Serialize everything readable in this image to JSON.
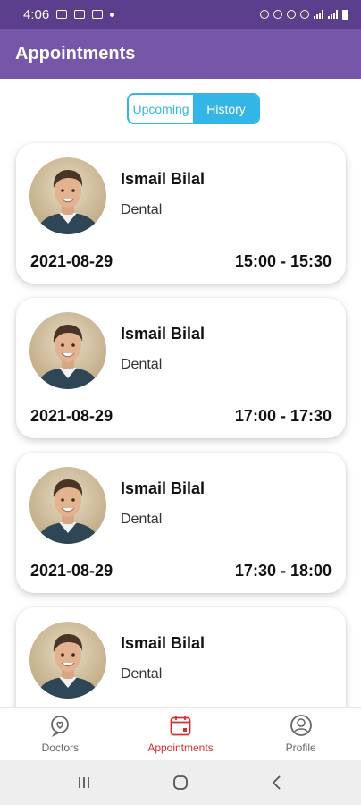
{
  "status_bar": {
    "time": "4:06"
  },
  "app_bar": {
    "title": "Appointments"
  },
  "segmented": {
    "upcoming_label": "Upcoming",
    "history_label": "History",
    "selected": "History"
  },
  "appointments": [
    {
      "name": "Ismail Bilal",
      "specialty": "Dental",
      "date": "2021-08-29",
      "time": "15:00 - 15:30"
    },
    {
      "name": "Ismail Bilal",
      "specialty": "Dental",
      "date": "2021-08-29",
      "time": "17:00 - 17:30"
    },
    {
      "name": "Ismail Bilal",
      "specialty": "Dental",
      "date": "2021-08-29",
      "time": "17:30 - 18:00"
    },
    {
      "name": "Ismail Bilal",
      "specialty": "Dental",
      "date": "",
      "time": ""
    }
  ],
  "bottom_nav": {
    "items": [
      {
        "label": "Doctors",
        "icon": "heart-bubble-icon",
        "active": false
      },
      {
        "label": "Appointments",
        "icon": "calendar-icon",
        "active": true
      },
      {
        "label": "Profile",
        "icon": "user-circle-icon",
        "active": false
      }
    ]
  },
  "colors": {
    "status_bar": "#5b3f8c",
    "app_bar": "#7556a8",
    "accent": "#33b5e5",
    "active_nav": "#d32f2f"
  }
}
